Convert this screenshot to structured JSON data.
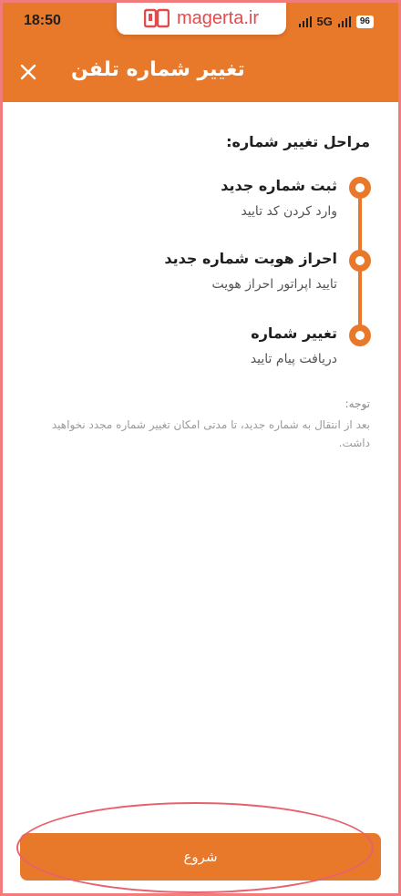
{
  "status_bar": {
    "time": "18:50",
    "network": "5G",
    "battery": "96"
  },
  "watermark": {
    "text": "magerta.ir",
    "icon": "book-logo-icon"
  },
  "header": {
    "title": "تغییر شماره تلفن",
    "close_icon": "close-icon"
  },
  "main": {
    "steps_title": "مراحل تغییر شماره:",
    "steps": [
      {
        "title": "ثبت شماره جدید",
        "subtitle": "وارد کردن کد تایید"
      },
      {
        "title": "احراز هویت شماره جدید",
        "subtitle": "تایید اپراتور احراز هویت"
      },
      {
        "title": "تغییر شماره",
        "subtitle": "دریافت پیام تایید"
      }
    ],
    "note_label": "توجه:",
    "note_text": "بعد از انتقال به شماره جدید، تا مدتی امکان تغییر شماره مجدد نخواهید داشت."
  },
  "footer": {
    "start_label": "شروع"
  },
  "colors": {
    "accent": "#e8782a",
    "frame": "#f27c7c",
    "highlight": "#e8606b"
  }
}
